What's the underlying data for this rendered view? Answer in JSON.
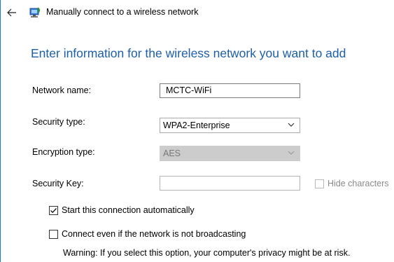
{
  "window": {
    "title": "Manually connect to a wireless network"
  },
  "heading": "Enter information for the wireless network you want to add",
  "form": {
    "network_name": {
      "label": "Network name:",
      "value": "MCTC-WiFi"
    },
    "security_type": {
      "label": "Security type:",
      "value": "WPA2-Enterprise"
    },
    "encryption_type": {
      "label": "Encryption type:",
      "value": "AES"
    },
    "security_key": {
      "label": "Security Key:",
      "value": ""
    },
    "hide_characters": {
      "label": "Hide characters",
      "checked": false
    }
  },
  "options": {
    "start_automatically": {
      "label": "Start this connection automatically",
      "checked": true
    },
    "connect_not_broadcasting": {
      "label": "Connect even if the network is not broadcasting",
      "checked": false
    },
    "warning": "Warning: If you select this option, your computer's privacy might be at risk."
  },
  "colors": {
    "heading": "#1c5fa8",
    "border_accent": "#1979ca",
    "disabled_field": "#cccccc"
  },
  "icons": {
    "back": "back-arrow-icon",
    "title": "wireless-network-icon",
    "dropdown": "chevron-down-icon"
  }
}
